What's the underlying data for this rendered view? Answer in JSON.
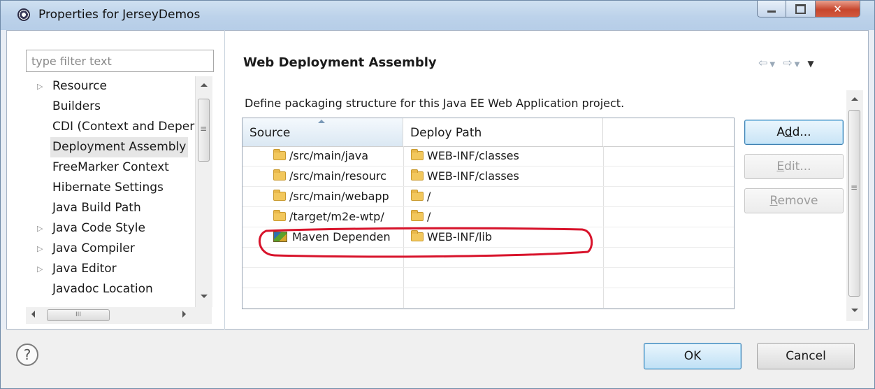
{
  "window": {
    "title": "Properties for JerseyDemos",
    "minimize_icon": "minimize-icon",
    "maximize_icon": "maximize-icon",
    "close_icon": "close-icon"
  },
  "filter": {
    "placeholder": "type filter text"
  },
  "tree": {
    "items": [
      {
        "label": "Resource",
        "expandable": true
      },
      {
        "label": "Builders",
        "expandable": false
      },
      {
        "label": "CDI (Context and Deper",
        "expandable": false
      },
      {
        "label": "Deployment Assembly",
        "expandable": false,
        "selected": true
      },
      {
        "label": "FreeMarker Context",
        "expandable": false
      },
      {
        "label": "Hibernate Settings",
        "expandable": false
      },
      {
        "label": "Java Build Path",
        "expandable": false
      },
      {
        "label": "Java Code Style",
        "expandable": true
      },
      {
        "label": "Java Compiler",
        "expandable": true
      },
      {
        "label": "Java Editor",
        "expandable": true
      },
      {
        "label": "Javadoc Location",
        "expandable": false
      }
    ],
    "hscroll_grip": "III"
  },
  "page": {
    "title": "Web Deployment Assembly",
    "description": "Define packaging structure for this Java EE Web Application project.",
    "nav": {
      "back_icon": "back-arrow-icon",
      "forward_icon": "forward-arrow-icon",
      "menu_icon": "view-menu-icon"
    }
  },
  "table": {
    "columns": [
      "Source",
      "Deploy Path",
      ""
    ],
    "rows": [
      {
        "source": "/src/main/java",
        "deploy": "WEB-INF/classes",
        "icon": "folder-icon"
      },
      {
        "source": "/src/main/resourc",
        "deploy": "WEB-INF/classes",
        "icon": "folder-icon"
      },
      {
        "source": "/src/main/webapp",
        "deploy": "/",
        "icon": "folder-icon"
      },
      {
        "source": "/target/m2e-wtp/",
        "deploy": "/",
        "icon": "folder-icon"
      },
      {
        "source": "Maven Dependen",
        "deploy": "WEB-INF/lib",
        "icon": "library-icon"
      }
    ]
  },
  "buttons": {
    "add": {
      "before": "A",
      "mnemonic": "d",
      "after": "d...",
      "enabled": true
    },
    "edit": {
      "before": "",
      "mnemonic": "E",
      "after": "dit...",
      "enabled": false
    },
    "remove": {
      "before": "",
      "mnemonic": "R",
      "after": "emove",
      "enabled": false
    }
  },
  "footer": {
    "help_icon": "help-icon",
    "help_glyph": "?",
    "ok_label": "OK",
    "cancel_label": "Cancel"
  },
  "colors": {
    "highlight": "#d8132b",
    "title_bar": "#bcd2ea",
    "selected_tree": "#e6e6e6"
  }
}
